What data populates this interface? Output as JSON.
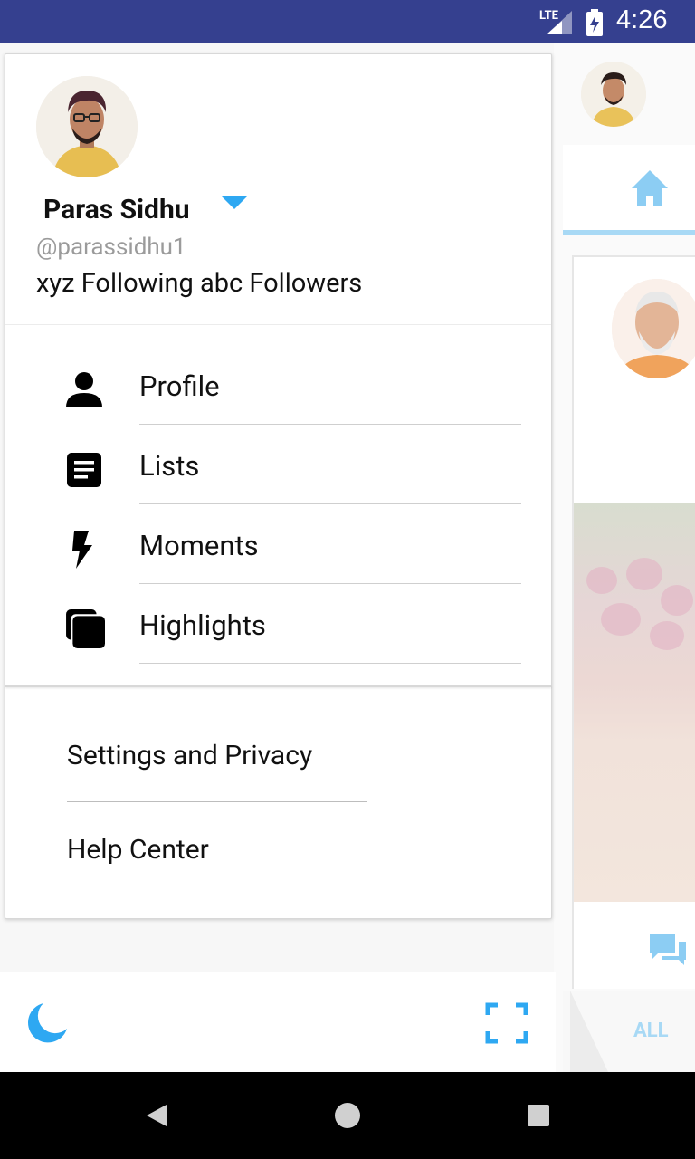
{
  "status_bar": {
    "network": "LTE",
    "time": "4:26"
  },
  "drawer": {
    "user": {
      "name": "Paras Sidhu",
      "handle": "@parassidhu1",
      "stats": "xyz Following abc Followers"
    },
    "menu": [
      {
        "label": "Profile",
        "icon": "person-icon"
      },
      {
        "label": "Lists",
        "icon": "list-icon"
      },
      {
        "label": "Moments",
        "icon": "bolt-icon"
      },
      {
        "label": "Highlights",
        "icon": "highlights-icon"
      }
    ],
    "links": [
      {
        "label": "Settings and Privacy"
      },
      {
        "label": "Help Center"
      }
    ],
    "bottom": {
      "night_mode_icon": "moon-icon",
      "scan_icon": "qr-scan-icon"
    }
  },
  "background": {
    "filter_label": "ALL"
  },
  "colors": {
    "status_bar": "#35408f",
    "accent": "#2ea8f2",
    "accent_light": "#a8d9f5"
  }
}
